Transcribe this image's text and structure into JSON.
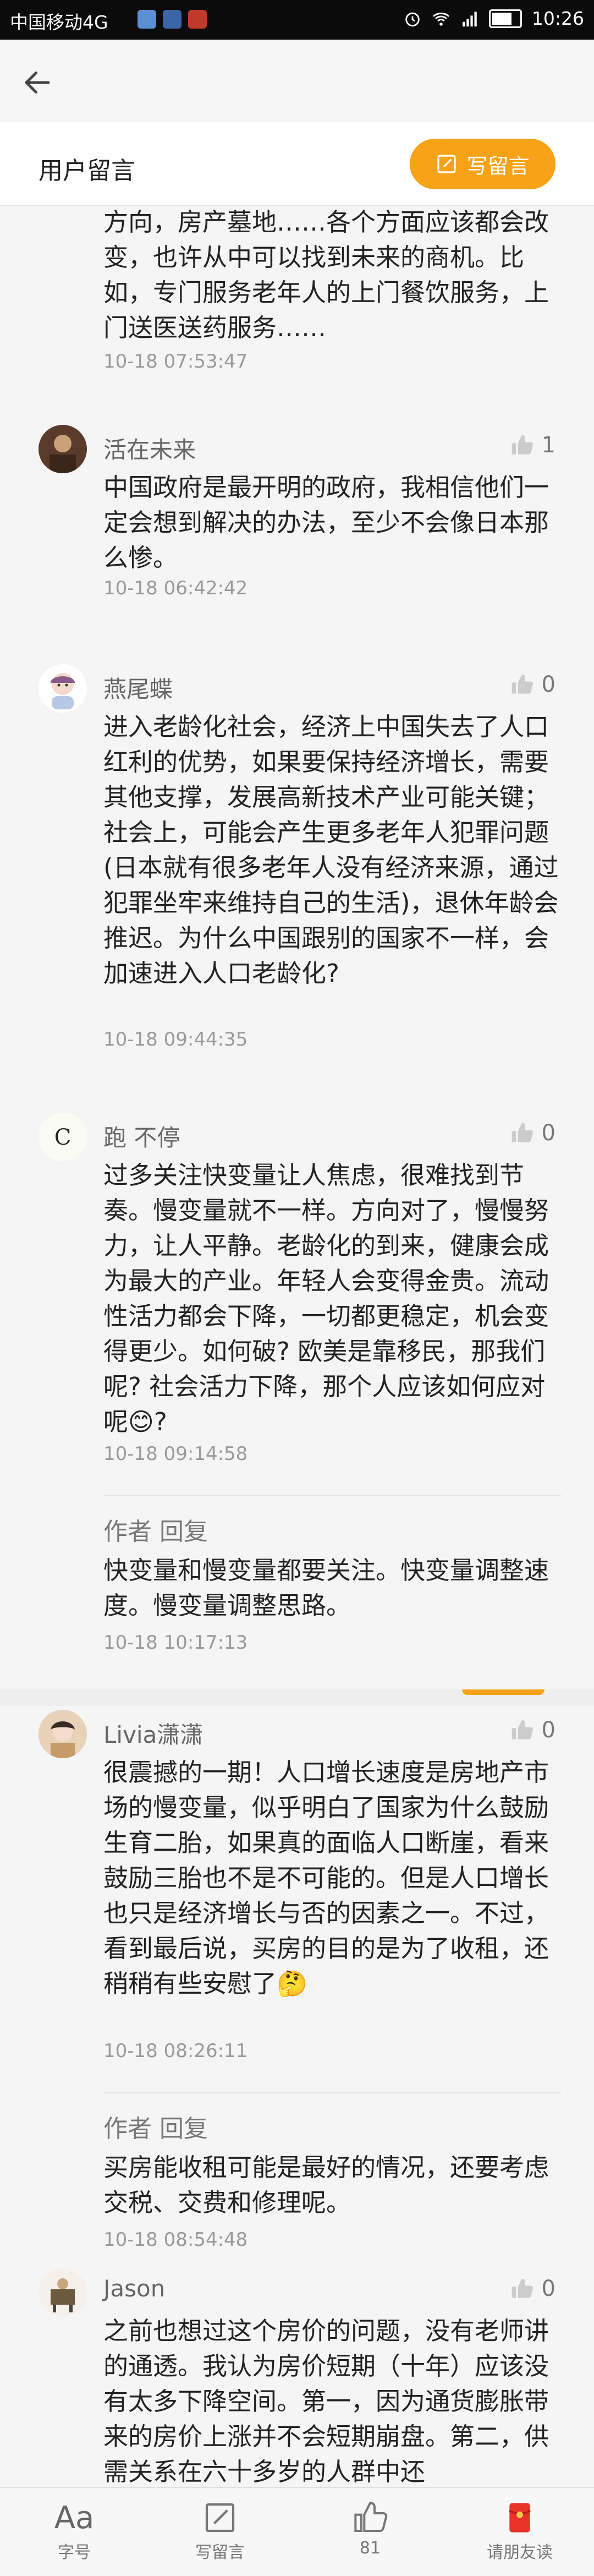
{
  "status_bar": {
    "carrier": "中国移动4G",
    "time": "10:26"
  },
  "header": {
    "title": "用户留言",
    "write_button": "写留言"
  },
  "comments": [
    {
      "text": "方向，房产墓地……各个方面应该都会改变，也许从中可以找到未来的商机。比如，专门服务老年人的上门餐饮服务，上门送医送药服务……",
      "time": "10-18 07:53:47"
    },
    {
      "name": "活在未来",
      "likes": "1",
      "text": "中国政府是最开明的政府，我相信他们一定会想到解决的办法，至少不会像日本那么惨。",
      "time": "10-18 06:42:42"
    },
    {
      "name": "燕尾蝶",
      "likes": "0",
      "text": "进入老龄化社会，经济上中国失去了人口红利的优势，如果要保持经济增长，需要其他支撑，发展高新技术产业可能关键；社会上，可能会产生更多老年人犯罪问题(日本就有很多老年人没有经济来源，通过犯罪坐牢来维持自己的生活)，退休年龄会推迟。为什么中国跟别的国家不一样，会加速进入人口老龄化?",
      "time": "10-18 09:44:35"
    },
    {
      "name": "跑 不停",
      "likes": "0",
      "text": "过多关注快变量让人焦虑，很难找到节奏。慢变量就不一样。方向对了，慢慢努力，让人平静。老龄化的到来，健康会成为最大的产业。年轻人会变得金贵。流动性活力都会下降，一切都更稳定，机会变得更少。如何破? 欧美是靠移民，那我们呢? 社会活力下降，那个人应该如何应对呢😊?",
      "time": "10-18 09:14:58",
      "reply": {
        "author": "作者 回复",
        "text": "快变量和慢变量都要关注。快变量调整速度。慢变量调整思路。",
        "time": "10-18 10:17:13"
      }
    },
    {
      "name": "Livia潇潇",
      "likes": "0",
      "text": "很震撼的一期！人口增长速度是房地产市场的慢变量，似乎明白了国家为什么鼓励生育二胎，如果真的面临人口断崖，看来鼓励三胎也不是不可能的。但是人口增长也只是经济增长与否的因素之一。不过，看到最后说，买房的目的是为了收租，还稍稍有些安慰了🤔",
      "time": "10-18 08:26:11",
      "reply": {
        "author": "作者 回复",
        "text": "买房能收租可能是最好的情况，还要考虑交税、交费和修理呢。",
        "time": "10-18 08:54:48"
      }
    },
    {
      "name": "Jason",
      "likes": "0",
      "text": "之前也想过这个房价的问题，没有老师讲的通透。我认为房价短期（十年）应该没有太多下降空间。第一，因为通货膨胀带来的房价上涨并不会短期崩盘。第二，供需关系在六十多岁的人群中还"
    }
  ],
  "bottom_bar": {
    "font_size": "字号",
    "write": "写留言",
    "likes": "81",
    "invite": "请朋友读"
  },
  "colors": {
    "accent": "#f7a217",
    "invite_red": "#e8332a"
  }
}
